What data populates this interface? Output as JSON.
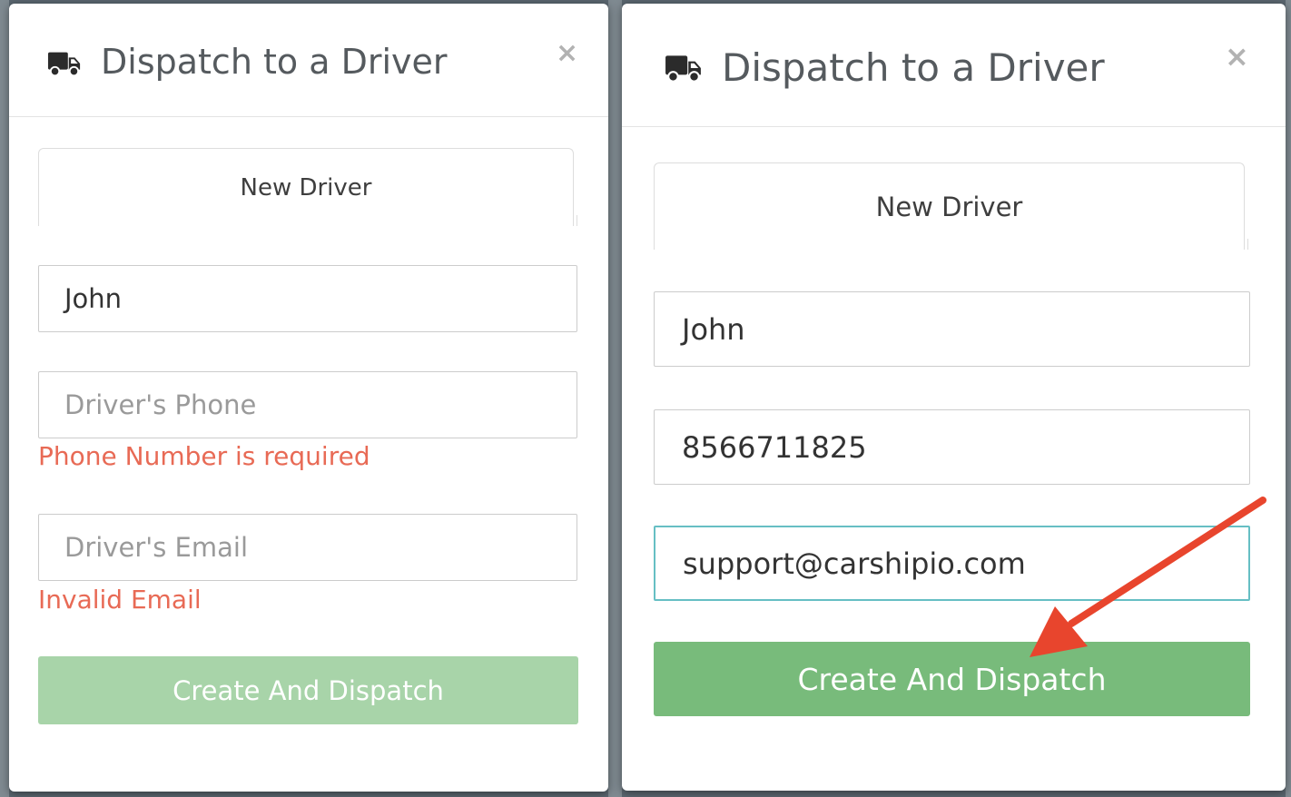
{
  "dialog": {
    "title": "Dispatch to a Driver",
    "close_label": "×",
    "tab_label": "New Driver",
    "button_label": "Create And Dispatch"
  },
  "left_dialog": {
    "name_value": "John",
    "phone_placeholder": "Driver's Phone",
    "phone_error": "Phone Number is required",
    "email_placeholder": "Driver's Email",
    "email_error": "Invalid Email",
    "button_state": "disabled"
  },
  "right_dialog": {
    "name_value": "John",
    "phone_value": "8566711825",
    "email_value": "support@carshipio.com",
    "button_state": "enabled"
  },
  "annotation": {
    "arrow_color": "#e8452d"
  },
  "colors": {
    "error": "#e86a55",
    "button_enabled": "#78bb7b",
    "button_disabled": "#a8d4a9",
    "focus_border": "#66bfc4"
  },
  "icons": [
    "truck-icon",
    "close-icon",
    "annotation-arrow"
  ]
}
